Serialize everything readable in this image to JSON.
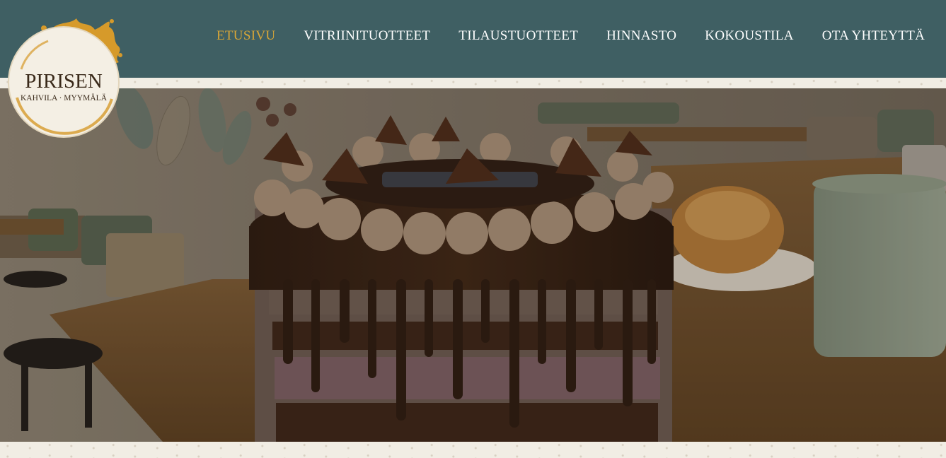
{
  "logo": {
    "name": "PIRISEN",
    "tagline": "KAHVILA · MYYMÄLÄ"
  },
  "nav": {
    "items": [
      {
        "label": "ETUSIVU",
        "active": true
      },
      {
        "label": "VITRIINITUOTTEET",
        "active": false
      },
      {
        "label": "TILAUSTUOTTEET",
        "active": false
      },
      {
        "label": "HINNASTO",
        "active": false
      },
      {
        "label": "KOKOUSTILA",
        "active": false
      },
      {
        "label": "OTA YHTEYTTÄ",
        "active": false
      }
    ]
  },
  "colors": {
    "header_bg": "#3f5f63",
    "nav_active": "#d9a637",
    "nav_text": "#ffffff",
    "paper": "#f1ede4"
  },
  "hero": {
    "image": "chocolate-cake-cafe-photo"
  }
}
